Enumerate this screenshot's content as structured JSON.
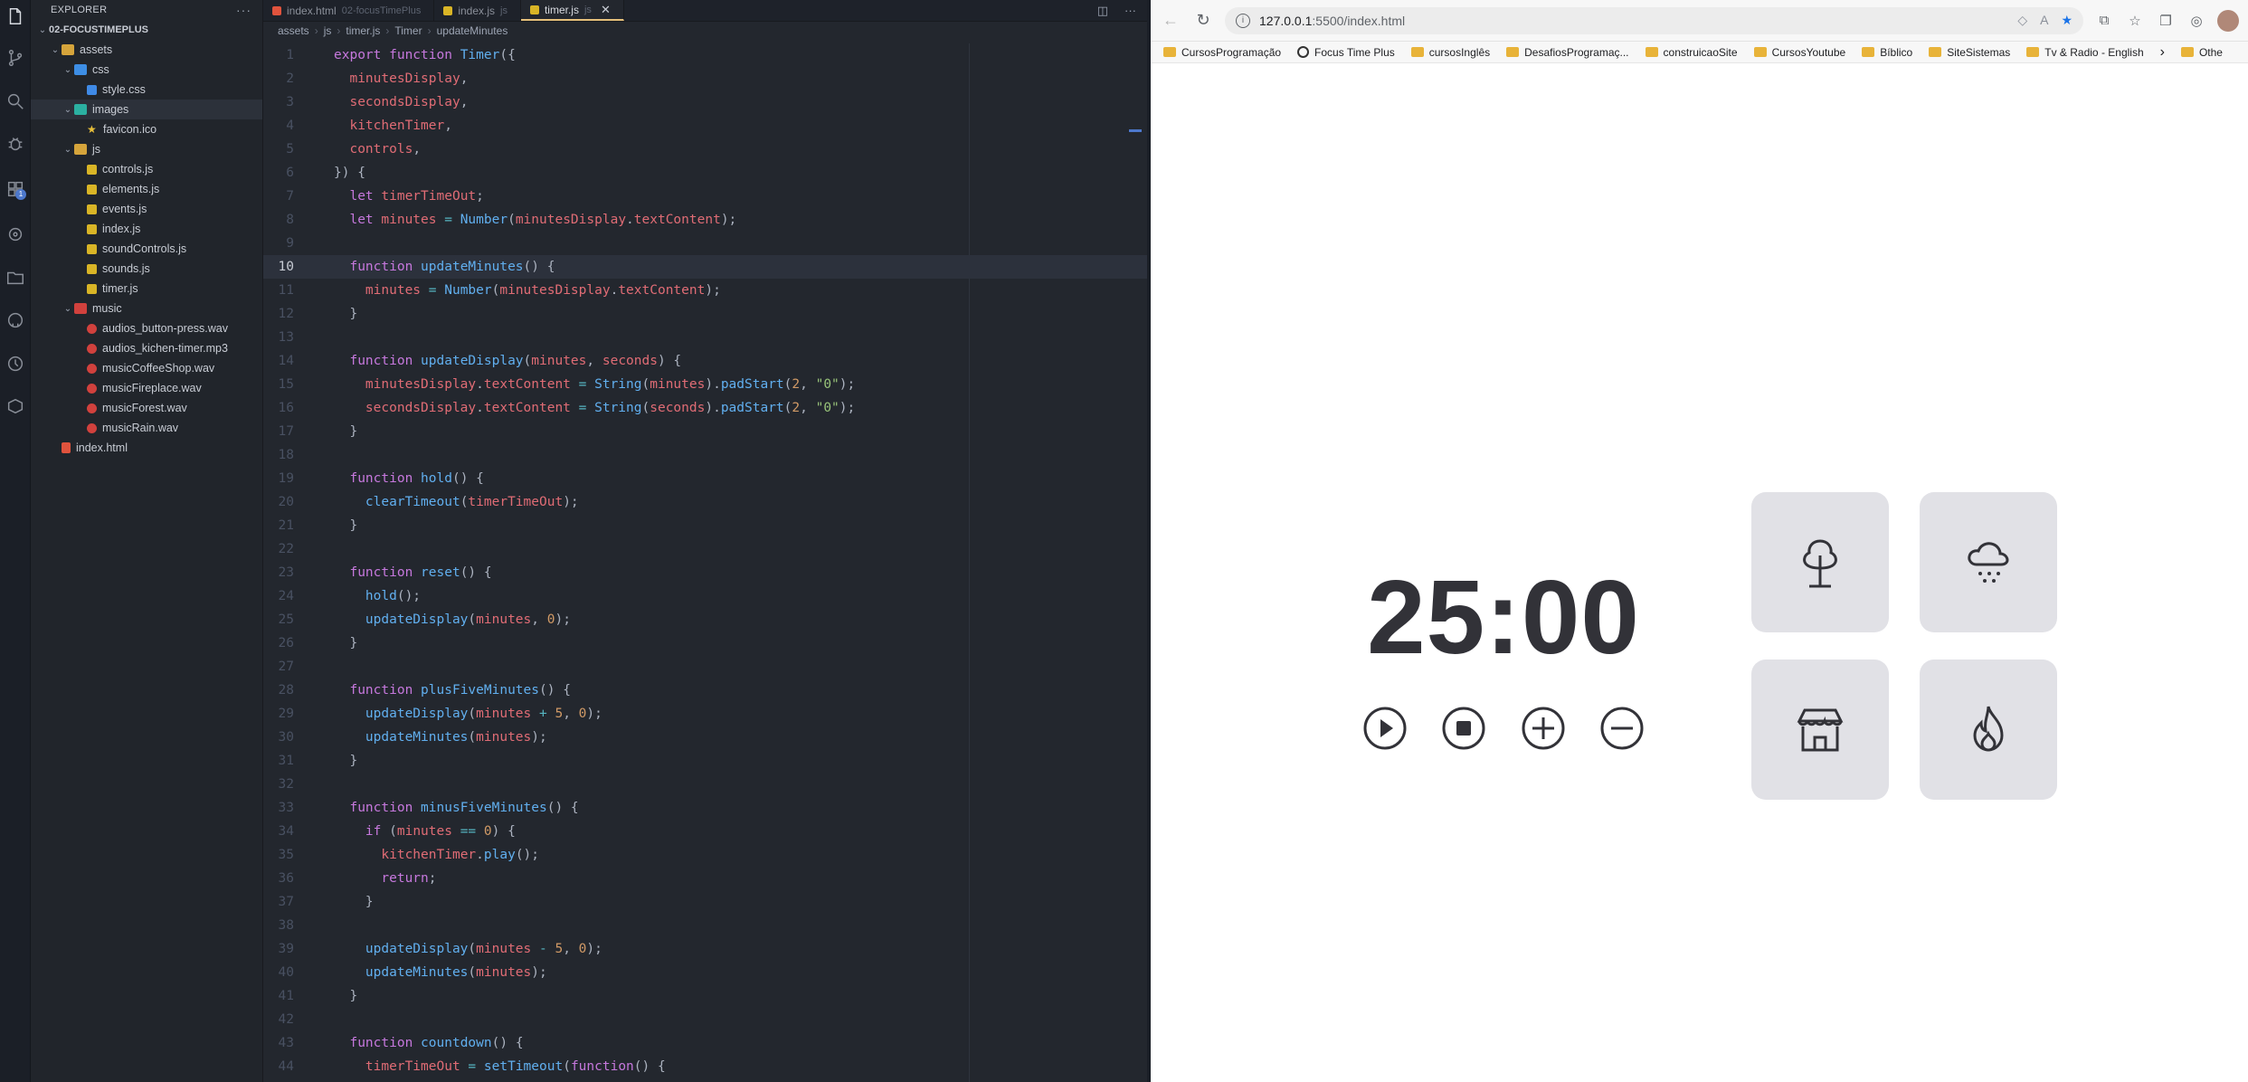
{
  "explorer": {
    "title": "EXPLORER",
    "project": "02-FOCUSTIMEPLUS",
    "tree": [
      {
        "label": "assets",
        "depth": 1,
        "type": "folder"
      },
      {
        "label": "css",
        "depth": 2,
        "type": "folder-blue"
      },
      {
        "label": "style.css",
        "depth": 3,
        "type": "css"
      },
      {
        "label": "images",
        "depth": 2,
        "type": "folder-teal",
        "selected": true
      },
      {
        "label": "favicon.ico",
        "depth": 3,
        "type": "star"
      },
      {
        "label": "js",
        "depth": 2,
        "type": "folder"
      },
      {
        "label": "controls.js",
        "depth": 3,
        "type": "js"
      },
      {
        "label": "elements.js",
        "depth": 3,
        "type": "js"
      },
      {
        "label": "events.js",
        "depth": 3,
        "type": "js"
      },
      {
        "label": "index.js",
        "depth": 3,
        "type": "js"
      },
      {
        "label": "soundControls.js",
        "depth": 3,
        "type": "js"
      },
      {
        "label": "sounds.js",
        "depth": 3,
        "type": "js"
      },
      {
        "label": "timer.js",
        "depth": 3,
        "type": "js"
      },
      {
        "label": "music",
        "depth": 2,
        "type": "folder-red"
      },
      {
        "label": "audios_button-press.wav",
        "depth": 3,
        "type": "audio"
      },
      {
        "label": "audios_kichen-timer.mp3",
        "depth": 3,
        "type": "audio"
      },
      {
        "label": "musicCoffeeShop.wav",
        "depth": 3,
        "type": "audio"
      },
      {
        "label": "musicFireplace.wav",
        "depth": 3,
        "type": "audio"
      },
      {
        "label": "musicForest.wav",
        "depth": 3,
        "type": "audio"
      },
      {
        "label": "musicRain.wav",
        "depth": 3,
        "type": "audio"
      },
      {
        "label": "index.html",
        "depth": 1,
        "type": "html"
      }
    ]
  },
  "editor": {
    "tabs": [
      {
        "label": "index.html",
        "sub": "02-focusTimePlus",
        "color": "#e0533d"
      },
      {
        "label": "index.js",
        "sub": "js",
        "color": "#d9b526"
      },
      {
        "label": "timer.js",
        "sub": "js",
        "color": "#d9b526",
        "active": true
      }
    ],
    "close_glyph": "✕",
    "breadcrumb": [
      "assets",
      "js",
      "timer.js",
      "Timer",
      "updateMinutes"
    ],
    "current_line": 10,
    "lines": [
      [
        [
          "k",
          "export "
        ],
        [
          "k",
          "function "
        ],
        [
          "f",
          "Timer"
        ],
        [
          "p",
          "({"
        ]
      ],
      [
        [
          "p",
          "  "
        ],
        [
          "v",
          "minutesDisplay"
        ],
        [
          "p",
          ","
        ]
      ],
      [
        [
          "p",
          "  "
        ],
        [
          "v",
          "secondsDisplay"
        ],
        [
          "p",
          ","
        ]
      ],
      [
        [
          "p",
          "  "
        ],
        [
          "v",
          "kitchenTimer"
        ],
        [
          "p",
          ","
        ]
      ],
      [
        [
          "p",
          "  "
        ],
        [
          "v",
          "controls"
        ],
        [
          "p",
          ","
        ]
      ],
      [
        [
          "p",
          "}) {"
        ]
      ],
      [
        [
          "p",
          "  "
        ],
        [
          "k",
          "let "
        ],
        [
          "v",
          "timerTimeOut"
        ],
        [
          "p",
          ";"
        ]
      ],
      [
        [
          "p",
          "  "
        ],
        [
          "k",
          "let "
        ],
        [
          "v",
          "minutes "
        ],
        [
          "c",
          "= "
        ],
        [
          "f",
          "Number"
        ],
        [
          "p",
          "("
        ],
        [
          "v",
          "minutesDisplay"
        ],
        [
          "p",
          "."
        ],
        [
          "v",
          "textContent"
        ],
        [
          "p",
          ");"
        ]
      ],
      [],
      [
        [
          "p",
          "  "
        ],
        [
          "k",
          "function "
        ],
        [
          "f",
          "updateMinutes"
        ],
        [
          "p",
          "() {"
        ]
      ],
      [
        [
          "p",
          "    "
        ],
        [
          "v",
          "minutes "
        ],
        [
          "c",
          "= "
        ],
        [
          "f",
          "Number"
        ],
        [
          "p",
          "("
        ],
        [
          "v",
          "minutesDisplay"
        ],
        [
          "p",
          "."
        ],
        [
          "v",
          "textContent"
        ],
        [
          "p",
          ");"
        ]
      ],
      [
        [
          "p",
          "  }"
        ]
      ],
      [],
      [
        [
          "p",
          "  "
        ],
        [
          "k",
          "function "
        ],
        [
          "f",
          "updateDisplay"
        ],
        [
          "p",
          "("
        ],
        [
          "v",
          "minutes"
        ],
        [
          "p",
          ", "
        ],
        [
          "v",
          "seconds"
        ],
        [
          "p",
          ") {"
        ]
      ],
      [
        [
          "p",
          "    "
        ],
        [
          "v",
          "minutesDisplay"
        ],
        [
          "p",
          "."
        ],
        [
          "v",
          "textContent "
        ],
        [
          "c",
          "= "
        ],
        [
          "f",
          "String"
        ],
        [
          "p",
          "("
        ],
        [
          "v",
          "minutes"
        ],
        [
          "p",
          ")."
        ],
        [
          "f",
          "padStart"
        ],
        [
          "p",
          "("
        ],
        [
          "n",
          "2"
        ],
        [
          "p",
          ", "
        ],
        [
          "s",
          "\"0\""
        ],
        [
          "p",
          ");"
        ]
      ],
      [
        [
          "p",
          "    "
        ],
        [
          "v",
          "secondsDisplay"
        ],
        [
          "p",
          "."
        ],
        [
          "v",
          "textContent "
        ],
        [
          "c",
          "= "
        ],
        [
          "f",
          "String"
        ],
        [
          "p",
          "("
        ],
        [
          "v",
          "seconds"
        ],
        [
          "p",
          ")."
        ],
        [
          "f",
          "padStart"
        ],
        [
          "p",
          "("
        ],
        [
          "n",
          "2"
        ],
        [
          "p",
          ", "
        ],
        [
          "s",
          "\"0\""
        ],
        [
          "p",
          ");"
        ]
      ],
      [
        [
          "p",
          "  }"
        ]
      ],
      [],
      [
        [
          "p",
          "  "
        ],
        [
          "k",
          "function "
        ],
        [
          "f",
          "hold"
        ],
        [
          "p",
          "() {"
        ]
      ],
      [
        [
          "p",
          "    "
        ],
        [
          "f",
          "clearTimeout"
        ],
        [
          "p",
          "("
        ],
        [
          "v",
          "timerTimeOut"
        ],
        [
          "p",
          ");"
        ]
      ],
      [
        [
          "p",
          "  }"
        ]
      ],
      [],
      [
        [
          "p",
          "  "
        ],
        [
          "k",
          "function "
        ],
        [
          "f",
          "reset"
        ],
        [
          "p",
          "() {"
        ]
      ],
      [
        [
          "p",
          "    "
        ],
        [
          "f",
          "hold"
        ],
        [
          "p",
          "();"
        ]
      ],
      [
        [
          "p",
          "    "
        ],
        [
          "f",
          "updateDisplay"
        ],
        [
          "p",
          "("
        ],
        [
          "v",
          "minutes"
        ],
        [
          "p",
          ", "
        ],
        [
          "n",
          "0"
        ],
        [
          "p",
          ");"
        ]
      ],
      [
        [
          "p",
          "  }"
        ]
      ],
      [],
      [
        [
          "p",
          "  "
        ],
        [
          "k",
          "function "
        ],
        [
          "f",
          "plusFiveMinutes"
        ],
        [
          "p",
          "() {"
        ]
      ],
      [
        [
          "p",
          "    "
        ],
        [
          "f",
          "updateDisplay"
        ],
        [
          "p",
          "("
        ],
        [
          "v",
          "minutes "
        ],
        [
          "c",
          "+ "
        ],
        [
          "n",
          "5"
        ],
        [
          "p",
          ", "
        ],
        [
          "n",
          "0"
        ],
        [
          "p",
          ");"
        ]
      ],
      [
        [
          "p",
          "    "
        ],
        [
          "f",
          "updateMinutes"
        ],
        [
          "p",
          "("
        ],
        [
          "v",
          "minutes"
        ],
        [
          "p",
          ");"
        ]
      ],
      [
        [
          "p",
          "  }"
        ]
      ],
      [],
      [
        [
          "p",
          "  "
        ],
        [
          "k",
          "function "
        ],
        [
          "f",
          "minusFiveMinutes"
        ],
        [
          "p",
          "() {"
        ]
      ],
      [
        [
          "p",
          "    "
        ],
        [
          "k",
          "if "
        ],
        [
          "p",
          "("
        ],
        [
          "v",
          "minutes "
        ],
        [
          "c",
          "== "
        ],
        [
          "n",
          "0"
        ],
        [
          "p",
          ") {"
        ]
      ],
      [
        [
          "p",
          "      "
        ],
        [
          "v",
          "kitchenTimer"
        ],
        [
          "p",
          "."
        ],
        [
          "f",
          "play"
        ],
        [
          "p",
          "();"
        ]
      ],
      [
        [
          "p",
          "      "
        ],
        [
          "k",
          "return"
        ],
        [
          "p",
          ";"
        ]
      ],
      [
        [
          "p",
          "    }"
        ]
      ],
      [],
      [
        [
          "p",
          "    "
        ],
        [
          "f",
          "updateDisplay"
        ],
        [
          "p",
          "("
        ],
        [
          "v",
          "minutes "
        ],
        [
          "c",
          "- "
        ],
        [
          "n",
          "5"
        ],
        [
          "p",
          ", "
        ],
        [
          "n",
          "0"
        ],
        [
          "p",
          ");"
        ]
      ],
      [
        [
          "p",
          "    "
        ],
        [
          "f",
          "updateMinutes"
        ],
        [
          "p",
          "("
        ],
        [
          "v",
          "minutes"
        ],
        [
          "p",
          ");"
        ]
      ],
      [
        [
          "p",
          "  }"
        ]
      ],
      [],
      [
        [
          "p",
          "  "
        ],
        [
          "k",
          "function "
        ],
        [
          "f",
          "countdown"
        ],
        [
          "p",
          "() {"
        ]
      ],
      [
        [
          "p",
          "    "
        ],
        [
          "v",
          "timerTimeOut "
        ],
        [
          "c",
          "= "
        ],
        [
          "f",
          "setTimeout"
        ],
        [
          "p",
          "("
        ],
        [
          "k",
          "function"
        ],
        [
          "p",
          "() {"
        ]
      ]
    ]
  },
  "browser": {
    "url_host": "127.0.0.1",
    "url_path": ":5500/index.html",
    "bookmarks": [
      {
        "label": "CursosProgramação",
        "type": "folder"
      },
      {
        "label": "Focus Time Plus",
        "type": "site"
      },
      {
        "label": "cursosInglês",
        "type": "folder"
      },
      {
        "label": "DesafiosProgramaç...",
        "type": "folder"
      },
      {
        "label": "construicaoSite",
        "type": "folder"
      },
      {
        "label": "CursosYoutube",
        "type": "folder"
      },
      {
        "label": "Bíblico",
        "type": "folder"
      },
      {
        "label": "SiteSistemas",
        "type": "folder"
      },
      {
        "label": "Tv & Radio - English",
        "type": "folder"
      },
      {
        "label": "Othe",
        "type": "folder"
      }
    ],
    "page": {
      "minutes": "25",
      "colon": ":",
      "seconds": "00",
      "sounds": [
        "forest",
        "rain",
        "coffee-shop",
        "fireplace"
      ]
    }
  },
  "colors": {
    "accent_tab": "#e5c07b",
    "timer_text": "#323238",
    "card_bg": "#e1e1e6"
  }
}
